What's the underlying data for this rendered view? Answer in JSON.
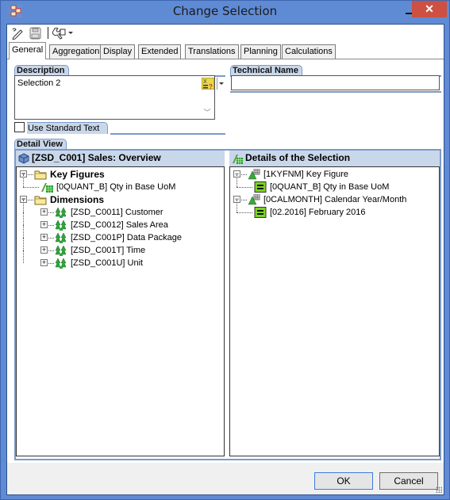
{
  "window": {
    "title": "Change Selection",
    "icons": {
      "app": "app-icon",
      "minimize": "minimize-icon",
      "maximize": "maximize-icon",
      "close": "close-icon"
    },
    "close_glyph": "✕"
  },
  "toolbar": {
    "items": [
      {
        "name": "edit-icon"
      },
      {
        "name": "save-icon"
      },
      {
        "name": "tools-icon",
        "has_dropdown": true
      }
    ]
  },
  "tabs": [
    {
      "label": "General",
      "active": true
    },
    {
      "label": "Aggregation",
      "active": false
    },
    {
      "label": "Display",
      "active": false
    },
    {
      "label": "Extended",
      "active": false
    },
    {
      "label": "Translations",
      "active": false
    },
    {
      "label": "Planning",
      "active": false
    },
    {
      "label": "Calculations",
      "active": false
    }
  ],
  "general": {
    "description": {
      "label": "Description",
      "value": "Selection 2",
      "scroll_up": "︿",
      "scroll_down": "﹀"
    },
    "use_standard_text": {
      "label": "Use Standard Text",
      "checked": false
    },
    "technical_name": {
      "label": "Technical Name",
      "value": ""
    },
    "detail_view": {
      "label": "Detail View",
      "left_tree": {
        "header": "[ZSD_C001] Sales: Overview",
        "nodes": [
          {
            "label": "Key Figures",
            "icon": "folder-icon",
            "level": 0,
            "expander": "−",
            "bold": true
          },
          {
            "label": "[0QUANT_B] Qty in Base UoM",
            "icon": "key-figure-icon",
            "level": 1
          },
          {
            "label": "Dimensions",
            "icon": "folder-icon",
            "level": 0,
            "expander": "−",
            "bold": true
          },
          {
            "label": "[ZSD_C0011] Customer",
            "icon": "dimension-icon",
            "level": 1,
            "expander": "+"
          },
          {
            "label": "[ZSD_C0012] Sales Area",
            "icon": "dimension-icon",
            "level": 1,
            "expander": "+"
          },
          {
            "label": "[ZSD_C001P] Data Package",
            "icon": "dimension-icon",
            "level": 1,
            "expander": "+"
          },
          {
            "label": "[ZSD_C001T] Time",
            "icon": "dimension-icon",
            "level": 1,
            "expander": "+"
          },
          {
            "label": "[ZSD_C001U] Unit",
            "icon": "dimension-icon",
            "level": 1,
            "expander": "+"
          }
        ]
      },
      "right_tree": {
        "header": "Details of the Selection",
        "nodes": [
          {
            "label": "[1KYFNM] Key Figure",
            "icon": "characteristic-icon",
            "level": 0,
            "expander": "−"
          },
          {
            "label": "[0QUANT_B] Qty in Base UoM",
            "icon": "equals-filter-icon",
            "level": 1
          },
          {
            "label": "[0CALMONTH] Calendar Year/Month",
            "icon": "characteristic-icon",
            "level": 0,
            "expander": "−"
          },
          {
            "label": "[02.2016] February 2016",
            "icon": "equals-filter-icon",
            "level": 1
          }
        ]
      }
    }
  },
  "buttons": {
    "ok": "OK",
    "cancel": "Cancel"
  }
}
